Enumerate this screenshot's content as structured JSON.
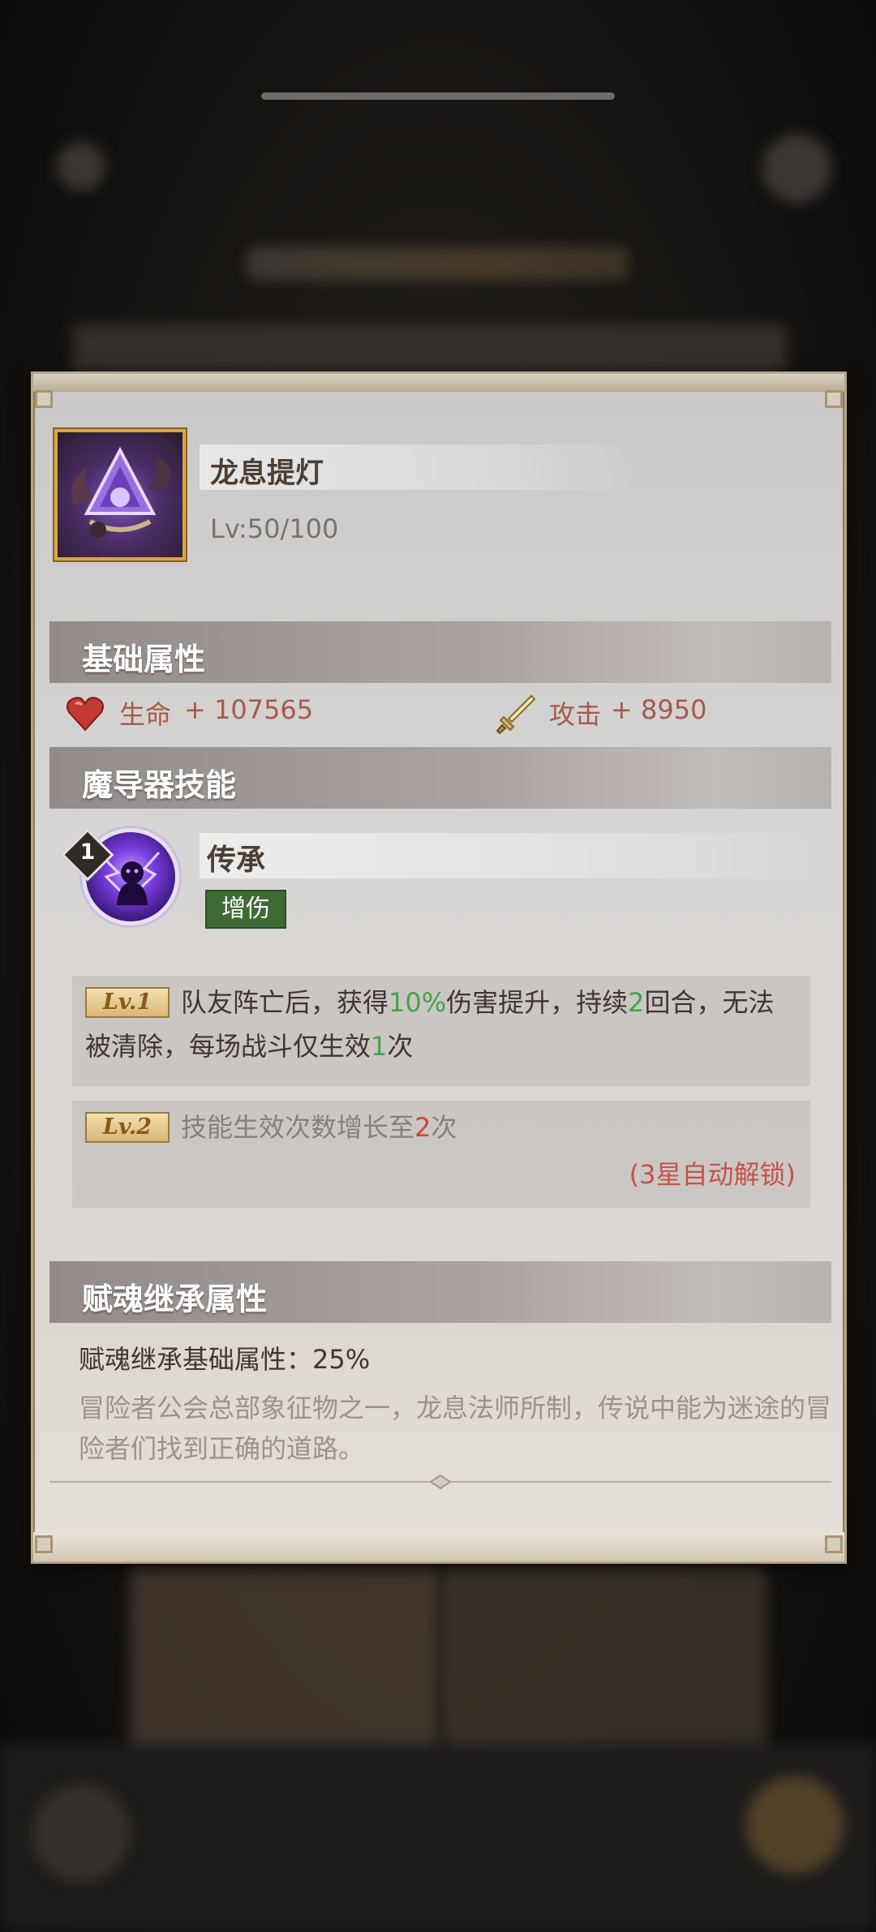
{
  "item": {
    "name": "龙息提灯",
    "level": "Lv:50/100",
    "icon": "dragon-lantern-icon"
  },
  "sections": {
    "basic_attributes": "基础属性",
    "device_skill": "魔导器技能",
    "soul_inheritance": "赋魂继承属性"
  },
  "stats": {
    "hp_label": "生命",
    "hp_value": "+ 107565",
    "atk_label": "攻击",
    "atk_value": "+ 8950",
    "hp_color": "#c23a32",
    "atk_color": "#d6b15f"
  },
  "skill": {
    "badge": "1",
    "name": "传承",
    "tag": "增伤",
    "tag_color": "#3e6b34",
    "levels": [
      {
        "badge": "Lv.1",
        "parts": [
          "队友阵亡后，获得",
          "10%",
          "伤害提升，持续",
          "2",
          "回合，无法被清除，每场战斗仅生效",
          "1",
          "次"
        ]
      },
      {
        "badge": "Lv.2",
        "parts": [
          "技能生效次数增长至",
          "2",
          "次"
        ],
        "unlock": "(3星自动解锁)"
      }
    ]
  },
  "inheritance": {
    "base_line": "赋魂继承基础属性：25%",
    "description": "冒险者公会总部象征物之一，龙息法师所制，传说中能为迷途的冒险者们找到正确的道路。"
  }
}
